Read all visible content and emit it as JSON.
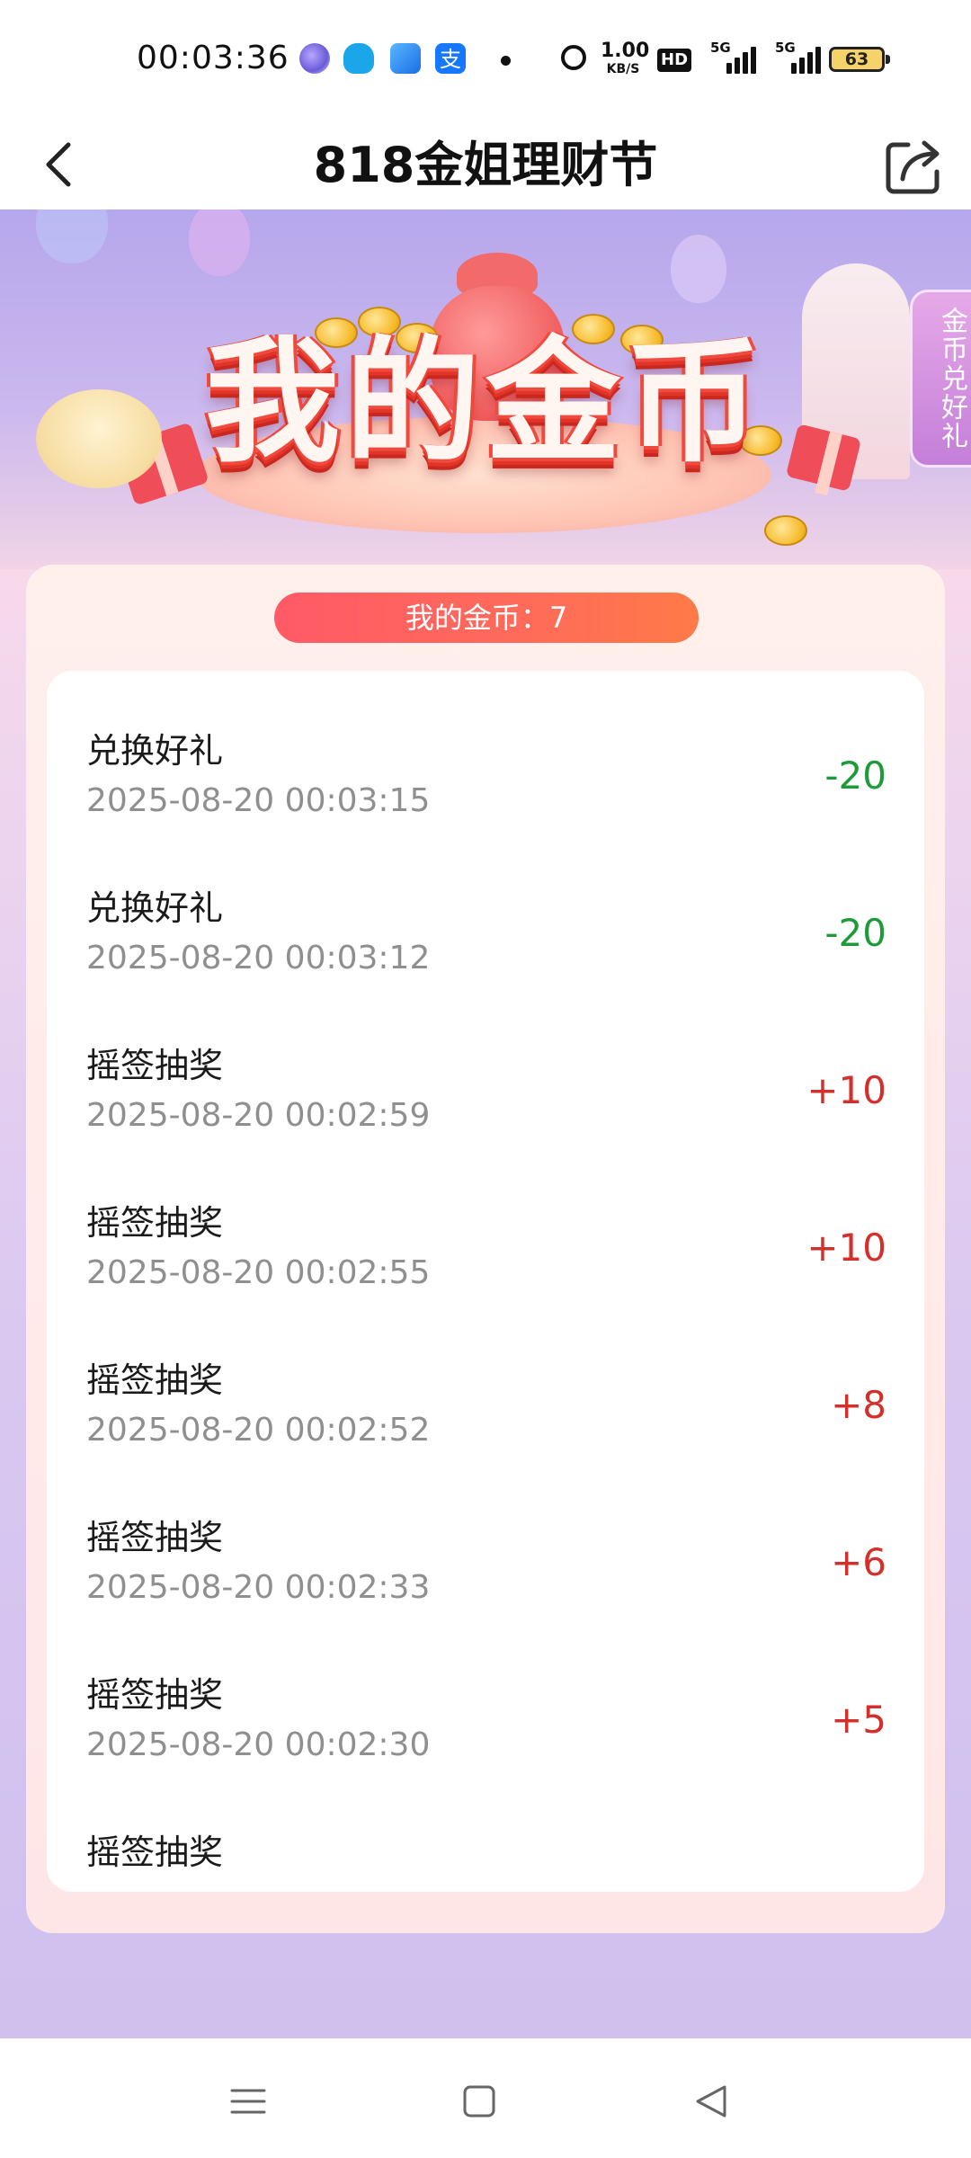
{
  "status_bar": {
    "time": "00:03:36",
    "speed_value": "1.00",
    "speed_unit": "KB/S",
    "hd_label": "HD",
    "signal1_label": "5G",
    "signal2_label": "5G",
    "battery": "63",
    "icons": [
      "app-circle-icon",
      "qq-icon",
      "browser-icon",
      "alipay-icon",
      "dot-icon",
      "alarm-icon"
    ]
  },
  "header": {
    "title": "818金姐理财节",
    "back_icon": "chevron-left-icon",
    "share_icon": "share-icon"
  },
  "banner": {
    "heading": "我的金币",
    "side_tab_label": "金币兑好礼"
  },
  "balance": {
    "text": "我的金币：7"
  },
  "records": [
    {
      "title": "兑换好礼",
      "time": "2025-08-20 00:03:15",
      "amount": "-20",
      "type": "spend"
    },
    {
      "title": "兑换好礼",
      "time": "2025-08-20 00:03:12",
      "amount": "-20",
      "type": "spend"
    },
    {
      "title": "摇签抽奖",
      "time": "2025-08-20 00:02:59",
      "amount": "+10",
      "type": "earn"
    },
    {
      "title": "摇签抽奖",
      "time": "2025-08-20 00:02:55",
      "amount": "+10",
      "type": "earn"
    },
    {
      "title": "摇签抽奖",
      "time": "2025-08-20 00:02:52",
      "amount": "+8",
      "type": "earn"
    },
    {
      "title": "摇签抽奖",
      "time": "2025-08-20 00:02:33",
      "amount": "+6",
      "type": "earn"
    },
    {
      "title": "摇签抽奖",
      "time": "2025-08-20 00:02:30",
      "amount": "+5",
      "type": "earn"
    },
    {
      "title": "摇签抽奖",
      "time": "",
      "amount": "",
      "type": "earn"
    }
  ],
  "colors": {
    "spend": "#1f9a3a",
    "earn": "#d4302b",
    "pill_start": "#ff5a67",
    "pill_end": "#ff7a48"
  },
  "nav_bar": {
    "icons": [
      "menu-icon",
      "home-square-icon",
      "back-triangle-icon"
    ]
  }
}
